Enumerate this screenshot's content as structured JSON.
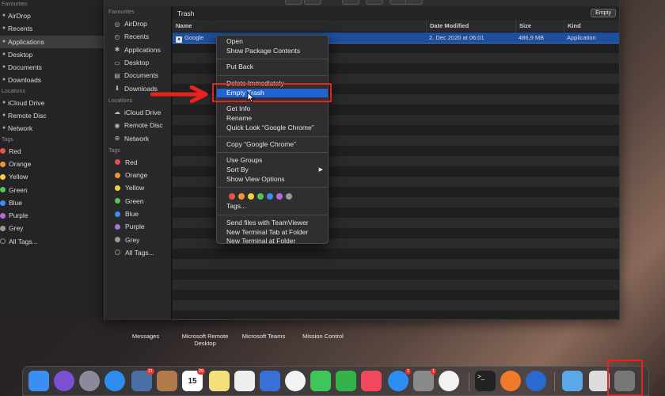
{
  "background_sidebar": {
    "sections": {
      "favourites": "Favourites",
      "locations": "Locations",
      "tags": "Tags"
    },
    "favourites": [
      "AirDrop",
      "Recents",
      "Applications",
      "Desktop",
      "Documents",
      "Downloads"
    ],
    "locations": [
      "iCloud Drive",
      "Remote Disc",
      "Network"
    ],
    "tags": [
      {
        "label": "Red",
        "color": "#e5534b"
      },
      {
        "label": "Orange",
        "color": "#f0963a"
      },
      {
        "label": "Yellow",
        "color": "#f2d33a"
      },
      {
        "label": "Green",
        "color": "#58c35a"
      },
      {
        "label": "Blue",
        "color": "#3d8cf0"
      },
      {
        "label": "Purple",
        "color": "#b06fd8"
      },
      {
        "label": "Grey",
        "color": "#9a9a9a"
      },
      {
        "label": "All Tags..."
      }
    ]
  },
  "sidebar": {
    "sections": {
      "favourites": "Favourites",
      "locations": "Locations",
      "tags": "Tags"
    },
    "favourites": [
      {
        "label": "AirDrop",
        "icon": "airdrop-icon"
      },
      {
        "label": "Recents",
        "icon": "clock-icon"
      },
      {
        "label": "Applications",
        "icon": "applications-icon"
      },
      {
        "label": "Desktop",
        "icon": "desktop-icon"
      },
      {
        "label": "Documents",
        "icon": "document-icon"
      },
      {
        "label": "Downloads",
        "icon": "download-icon"
      }
    ],
    "locations": [
      {
        "label": "iCloud Drive",
        "icon": "cloud-icon"
      },
      {
        "label": "Remote Disc",
        "icon": "disc-icon"
      },
      {
        "label": "Network",
        "icon": "globe-icon"
      }
    ],
    "tags": [
      {
        "label": "Red",
        "color": "#e5534b"
      },
      {
        "label": "Orange",
        "color": "#f0963a"
      },
      {
        "label": "Yellow",
        "color": "#f2d33a"
      },
      {
        "label": "Green",
        "color": "#58c35a"
      },
      {
        "label": "Blue",
        "color": "#3d8cf0"
      },
      {
        "label": "Purple",
        "color": "#b06fd8"
      },
      {
        "label": "Grey",
        "color": "#9a9a9a"
      },
      {
        "label": "All Tags..."
      }
    ]
  },
  "window": {
    "title": "Trash",
    "empty_button": "Empty",
    "columns": [
      "Name",
      "Date Modified",
      "Size",
      "Kind"
    ],
    "file": {
      "name": "Google",
      "date": "2. Dec 2020 at 06:01",
      "size": "486,9 MB",
      "kind": "Application"
    }
  },
  "context_menu": {
    "group1": [
      "Open",
      "Show Package Contents"
    ],
    "group2": [
      "Put Back"
    ],
    "group3": [
      "Delete Immediately",
      "Empty Trash"
    ],
    "group4": [
      "Get Info",
      "Rename",
      "Quick Look “Google Chrome”"
    ],
    "group5": [
      "Copy “Google Chrome”"
    ],
    "group6": [
      "Use Groups",
      "Sort By",
      "Show View Options"
    ],
    "tag_colors": [
      "#e5534b",
      "#f0963a",
      "#f2d33a",
      "#58c35a",
      "#3d8cf0",
      "#b06fd8",
      "#9a9a9a"
    ],
    "tags_item": "Tags...",
    "group7": [
      "Send files with TeamViewer",
      "New Terminal Tab at Folder",
      "New Terminal at Folder"
    ],
    "highlighted": "Empty Trash"
  },
  "launchpad": [
    "Messages",
    "Microsoft Remote Desktop",
    "Microsoft Teams",
    "Mission Control"
  ],
  "dock": {
    "items": [
      {
        "name": "finder-icon",
        "color": "#3a8ff0"
      },
      {
        "name": "siri-icon",
        "color": "#7a4fd1"
      },
      {
        "name": "launchpad-icon",
        "color": "#8a8a9a"
      },
      {
        "name": "safari-icon",
        "color": "#2d8cf0"
      },
      {
        "name": "photo-slideshow-icon",
        "color": "#4a6fa5",
        "badge": "21"
      },
      {
        "name": "contacts-icon",
        "color": "#b07a4a"
      },
      {
        "name": "calendar-icon",
        "color": "#ffffff",
        "badge": "29",
        "text": "15"
      },
      {
        "name": "notes-icon",
        "color": "#f4e07a"
      },
      {
        "name": "reminders-icon",
        "color": "#eeeeee"
      },
      {
        "name": "keynote-icon",
        "color": "#3a6fd8"
      },
      {
        "name": "photos-icon",
        "color": "#f3f3f3"
      },
      {
        "name": "messages-icon",
        "color": "#3fc65a"
      },
      {
        "name": "facetime-icon",
        "color": "#35b34a"
      },
      {
        "name": "music-icon",
        "color": "#f24a5a"
      },
      {
        "name": "app-store-icon",
        "color": "#2f8cf0",
        "badge": "1"
      },
      {
        "name": "system-preferences-icon",
        "color": "#8a8a8a",
        "badge": "1"
      },
      {
        "name": "chrome-icon",
        "color": "#f2f2f2"
      },
      {
        "name": "terminal-icon",
        "color": "#222222"
      },
      {
        "name": "firefox-icon",
        "color": "#f07a2a"
      },
      {
        "name": "edge-icon",
        "color": "#2a6ad0"
      },
      {
        "name": "downloads-folder-icon",
        "color": "#5aa8e8"
      },
      {
        "name": "preview-icon",
        "color": "#dddddd"
      },
      {
        "name": "trash-icon",
        "color": "#777777"
      }
    ],
    "calendar_day": "15"
  }
}
